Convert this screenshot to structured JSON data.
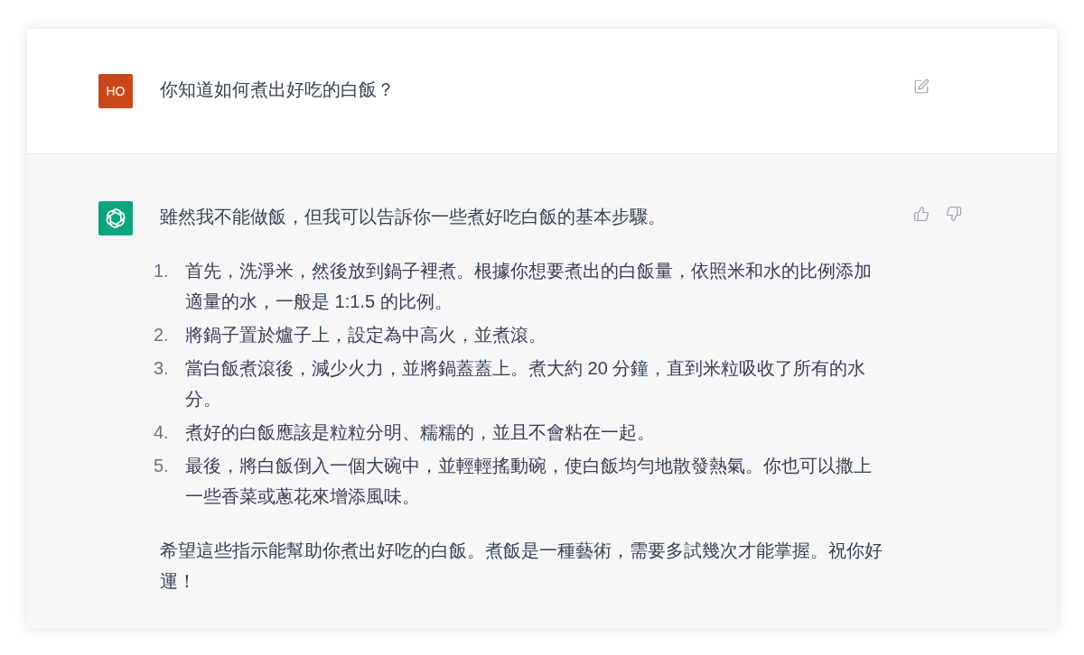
{
  "conversation": [
    {
      "kind": "user",
      "avatar": "HO",
      "blocks": [
        {
          "kind": "paragraph",
          "text": "你知道如何煮出好吃的白飯？"
        }
      ]
    },
    {
      "kind": "assistant",
      "blocks": [
        {
          "kind": "paragraph",
          "text": "雖然我不能做飯，但我可以告訴你一些煮好吃白飯的基本步驟。"
        },
        {
          "kind": "list",
          "items": [
            {
              "marker": "1.",
              "text": "首先，洗淨米，然後放到鍋子裡煮。根據你想要煮出的白飯量，依照米和水的比例添加適量的水，一般是 1:1.5 的比例。"
            },
            {
              "marker": "2.",
              "text": "將鍋子置於爐子上，設定為中高火，並煮滾。"
            },
            {
              "marker": "3.",
              "text": "當白飯煮滾後，減少火力，並將鍋蓋蓋上。煮大約 20 分鐘，直到米粒吸收了所有的水分。"
            },
            {
              "marker": "4.",
              "text": "煮好的白飯應該是粒粒分明、糯糯的，並且不會粘在一起。"
            },
            {
              "marker": "5.",
              "text": "最後，將白飯倒入一個大碗中，並輕輕搖動碗，使白飯均勻地散發熱氣。你也可以撒上一些香菜或蔥花來增添風味。"
            }
          ]
        },
        {
          "kind": "paragraph",
          "text": "希望這些指示能幫助你煮出好吃的白飯。煮飯是一種藝術，需要多試幾次才能掌握。祝你好運！"
        }
      ]
    }
  ]
}
